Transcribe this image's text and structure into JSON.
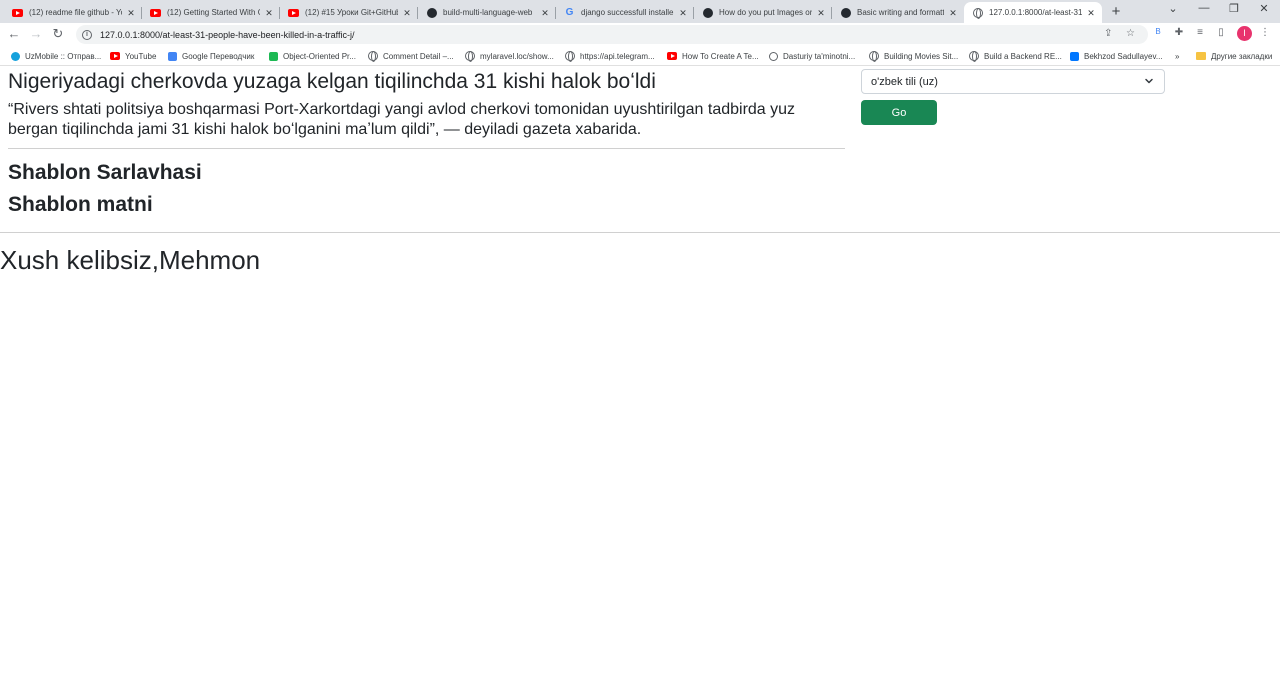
{
  "browser": {
    "tabs": [
      {
        "title": "(12) readme file github - Yo",
        "icon": "youtube-icon"
      },
      {
        "title": "(12) Getting Started With G",
        "icon": "youtube-icon"
      },
      {
        "title": "(12) #15 Уроки Git+GitHub",
        "icon": "youtube-icon"
      },
      {
        "title": "build-multi-language-web",
        "icon": "github-icon"
      },
      {
        "title": "django successfull installe",
        "icon": "google-icon"
      },
      {
        "title": "How do you put Images or",
        "icon": "github-icon"
      },
      {
        "title": "Basic writing and formattin",
        "icon": "github-icon"
      },
      {
        "title": "127.0.0.1:8000/at-least-31-",
        "icon": "globe-icon",
        "active": true
      }
    ],
    "new_tab": "+",
    "address": "127.0.0.1:8000/at-least-31-people-have-been-killed-in-a-traffic-j/",
    "profile_initial": "I",
    "bookmarks": [
      {
        "label": "UzMobile :: Отправ...",
        "icon": "uzmobile-icon"
      },
      {
        "label": "YouTube",
        "icon": "youtube-icon"
      },
      {
        "label": "Google Переводчик",
        "icon": "translate-icon"
      },
      {
        "label": "Object-Oriented Pr...",
        "icon": "bookmark-icon"
      },
      {
        "label": "Comment Detail –...",
        "icon": "globe-icon"
      },
      {
        "label": "mylaravel.loc/show...",
        "icon": "globe-icon"
      },
      {
        "label": "https://api.telegram...",
        "icon": "globe-icon"
      },
      {
        "label": "How To Create A Te...",
        "icon": "youtube-icon"
      },
      {
        "label": "Dasturiy ta'minotni...",
        "icon": "bulb-icon"
      },
      {
        "label": "Building Movies Sit...",
        "icon": "globe-icon"
      },
      {
        "label": "Build a Backend RE...",
        "icon": "globe-icon"
      },
      {
        "label": "Bekhzod Sadullayev...",
        "icon": "vk-icon"
      }
    ],
    "more_bookmarks": "»",
    "other_bookmarks": "Другие закладки"
  },
  "page": {
    "news_title": "Nigeriyadagi cherkovda yuzaga kelgan tiqilinchda 31 kishi halok boʻldi",
    "news_text": "“Rivers shtati politsiya boshqarmasi Port-Xarkortdagi yangi avlod cherkovi tomonidan uyushtirilgan tadbirda yuz bergan tiqilinchda jami 31 kishi halok boʻlganini maʼlum qildi”, — deyiladi gazeta xabarida.",
    "template_title": "Shablon Sarlavhasi",
    "template_text": "Shablon matni",
    "welcome": "Xush kelibsiz,Mehmon",
    "language_select": "o'zbek tili (uz)",
    "go_label": "Go"
  },
  "colors": {
    "go_button": "#198754",
    "tab_strip": "#dee1e6",
    "profile": "#e8336d"
  }
}
